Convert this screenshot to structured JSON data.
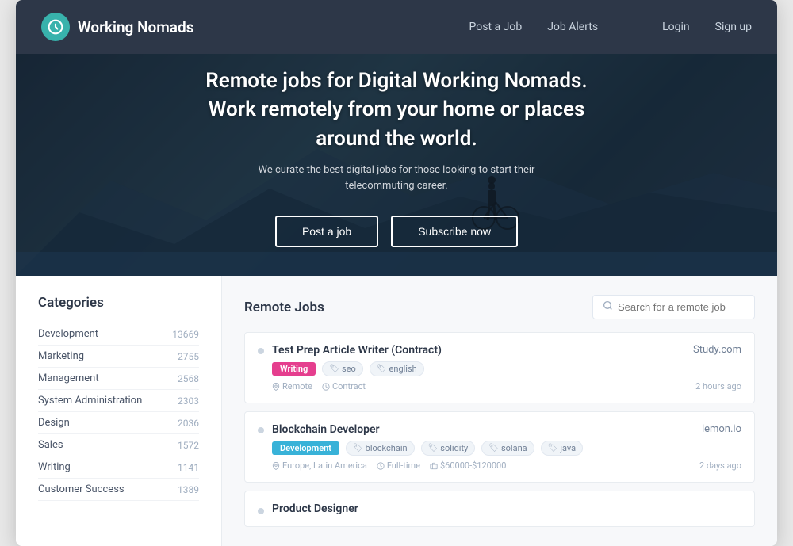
{
  "navbar": {
    "logo_icon": "🧭",
    "logo_text": "Working Nomads",
    "links": [
      {
        "label": "Post a Job",
        "id": "post-a-job"
      },
      {
        "label": "Job Alerts",
        "id": "job-alerts"
      },
      {
        "label": "Login",
        "id": "login"
      },
      {
        "label": "Sign up",
        "id": "sign-up"
      }
    ]
  },
  "hero": {
    "title": "Remote jobs for Digital Working Nomads.\nWork remotely from your home or places\naround the world.",
    "subtitle": "We curate the best digital jobs for those looking to start their\ntelecommuting career.",
    "btn_post_job": "Post a job",
    "btn_subscribe": "Subscribe now"
  },
  "sidebar": {
    "title": "Categories",
    "categories": [
      {
        "name": "Development",
        "count": "13669"
      },
      {
        "name": "Marketing",
        "count": "2755"
      },
      {
        "name": "Management",
        "count": "2568"
      },
      {
        "name": "System Administration",
        "count": "2303"
      },
      {
        "name": "Design",
        "count": "2036"
      },
      {
        "name": "Sales",
        "count": "1572"
      },
      {
        "name": "Writing",
        "count": "1141"
      },
      {
        "name": "Customer Success",
        "count": "1389"
      }
    ]
  },
  "job_section": {
    "title": "Remote Jobs",
    "search_placeholder": "Search for a remote job",
    "jobs": [
      {
        "id": "job-1",
        "title": "Test Prep Article Writer (Contract)",
        "company": "Study.com",
        "category_badge": "Writing",
        "category_color": "writing",
        "tags": [
          "seo",
          "english"
        ],
        "locations": [
          "Remote",
          "Contract"
        ],
        "posted": "2 hours ago"
      },
      {
        "id": "job-2",
        "title": "Blockchain Developer",
        "company": "lemon.io",
        "category_badge": "Development",
        "category_color": "development",
        "tags": [
          "blockchain",
          "solidity",
          "solana",
          "java"
        ],
        "locations": [
          "Europe, Latin America",
          "Full-time",
          "$60000-$120000"
        ],
        "posted": "2 days ago"
      },
      {
        "id": "job-3",
        "title": "Product Designer",
        "company": "---",
        "category_badge": "",
        "category_color": "",
        "tags": [],
        "locations": [],
        "posted": ""
      }
    ]
  },
  "icons": {
    "search": "🔍",
    "location_pin": "📍",
    "clock": "🕐",
    "tag": "🏷",
    "bag": "💼",
    "money": "💰"
  }
}
